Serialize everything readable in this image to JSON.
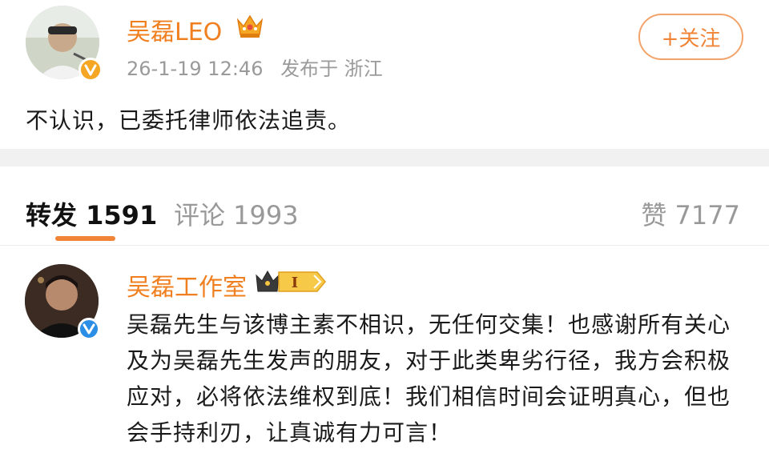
{
  "post": {
    "username": "吴磊LEO",
    "date": "26-1-19 12:46",
    "published_in_label": "发布于 浙江",
    "follow_label": "+关注",
    "text": "不认识，已委托律师依法追责。",
    "avatar_icon": "user-avatar",
    "verified_badge_color": "#f5a623"
  },
  "tabs": {
    "repost": "转发 1591",
    "comment": "评论 1993",
    "like": "赞 7177",
    "active_color": "#f08437"
  },
  "reply": {
    "username": "吴磊工作室",
    "vip_level": "I",
    "text_lines": [
      "吴磊先生与该博主素不相识，无任何交集！也感谢所有关心",
      "及为吴磊先生发声的朋友，对于此类卑劣行径，我方会积极",
      "应对，必将依法维权到底！我们相信时间会证明真心，但也",
      "会手持利刃，让真诚有力可言！"
    ],
    "verified_badge_color": "#2a8de6"
  },
  "colors": {
    "username": "#f07f1f",
    "meta": "#9a9a9a",
    "divider": "#f1f1f1"
  }
}
